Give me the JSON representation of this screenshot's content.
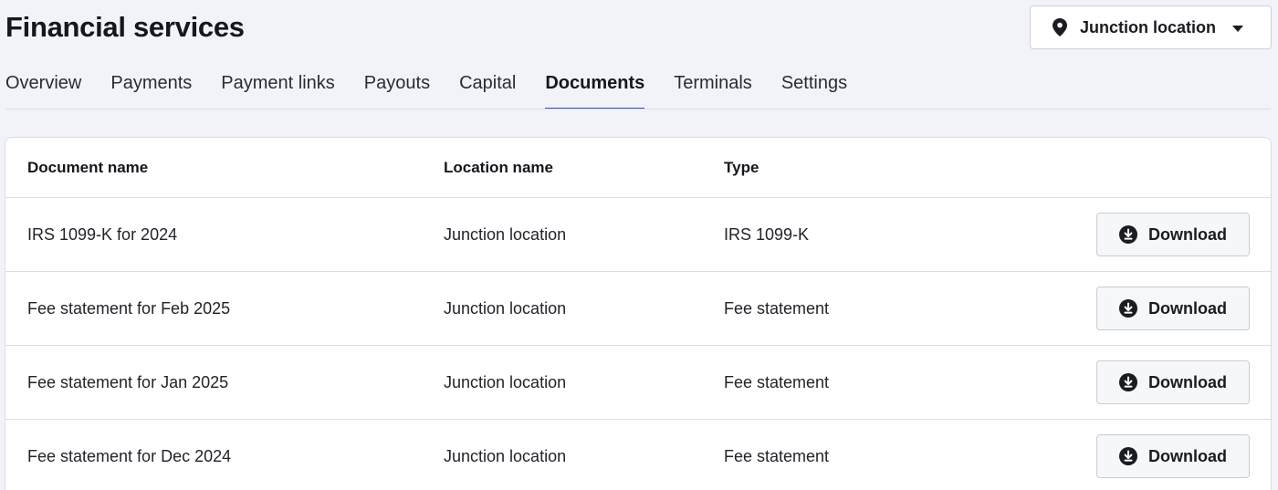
{
  "page": {
    "title": "Financial services"
  },
  "location_selector": {
    "label": "Junction location",
    "icon": "map-pin-icon"
  },
  "tabs": [
    {
      "label": "Overview",
      "active": false
    },
    {
      "label": "Payments",
      "active": false
    },
    {
      "label": "Payment links",
      "active": false
    },
    {
      "label": "Payouts",
      "active": false
    },
    {
      "label": "Capital",
      "active": false
    },
    {
      "label": "Documents",
      "active": true
    },
    {
      "label": "Terminals",
      "active": false
    },
    {
      "label": "Settings",
      "active": false
    }
  ],
  "table": {
    "columns": [
      "Document name",
      "Location name",
      "Type"
    ],
    "rows": [
      {
        "document_name": "IRS 1099-K for 2024",
        "location_name": "Junction location",
        "type": "IRS 1099-K",
        "action": "Download"
      },
      {
        "document_name": "Fee statement for Feb 2025",
        "location_name": "Junction location",
        "type": "Fee statement",
        "action": "Download"
      },
      {
        "document_name": "Fee statement for Jan 2025",
        "location_name": "Junction location",
        "type": "Fee statement",
        "action": "Download"
      },
      {
        "document_name": "Fee statement for Dec 2024",
        "location_name": "Junction location",
        "type": "Fee statement",
        "action": "Download"
      }
    ]
  },
  "colors": {
    "accent": "#3c4bd6",
    "background": "#f2f3f8"
  }
}
